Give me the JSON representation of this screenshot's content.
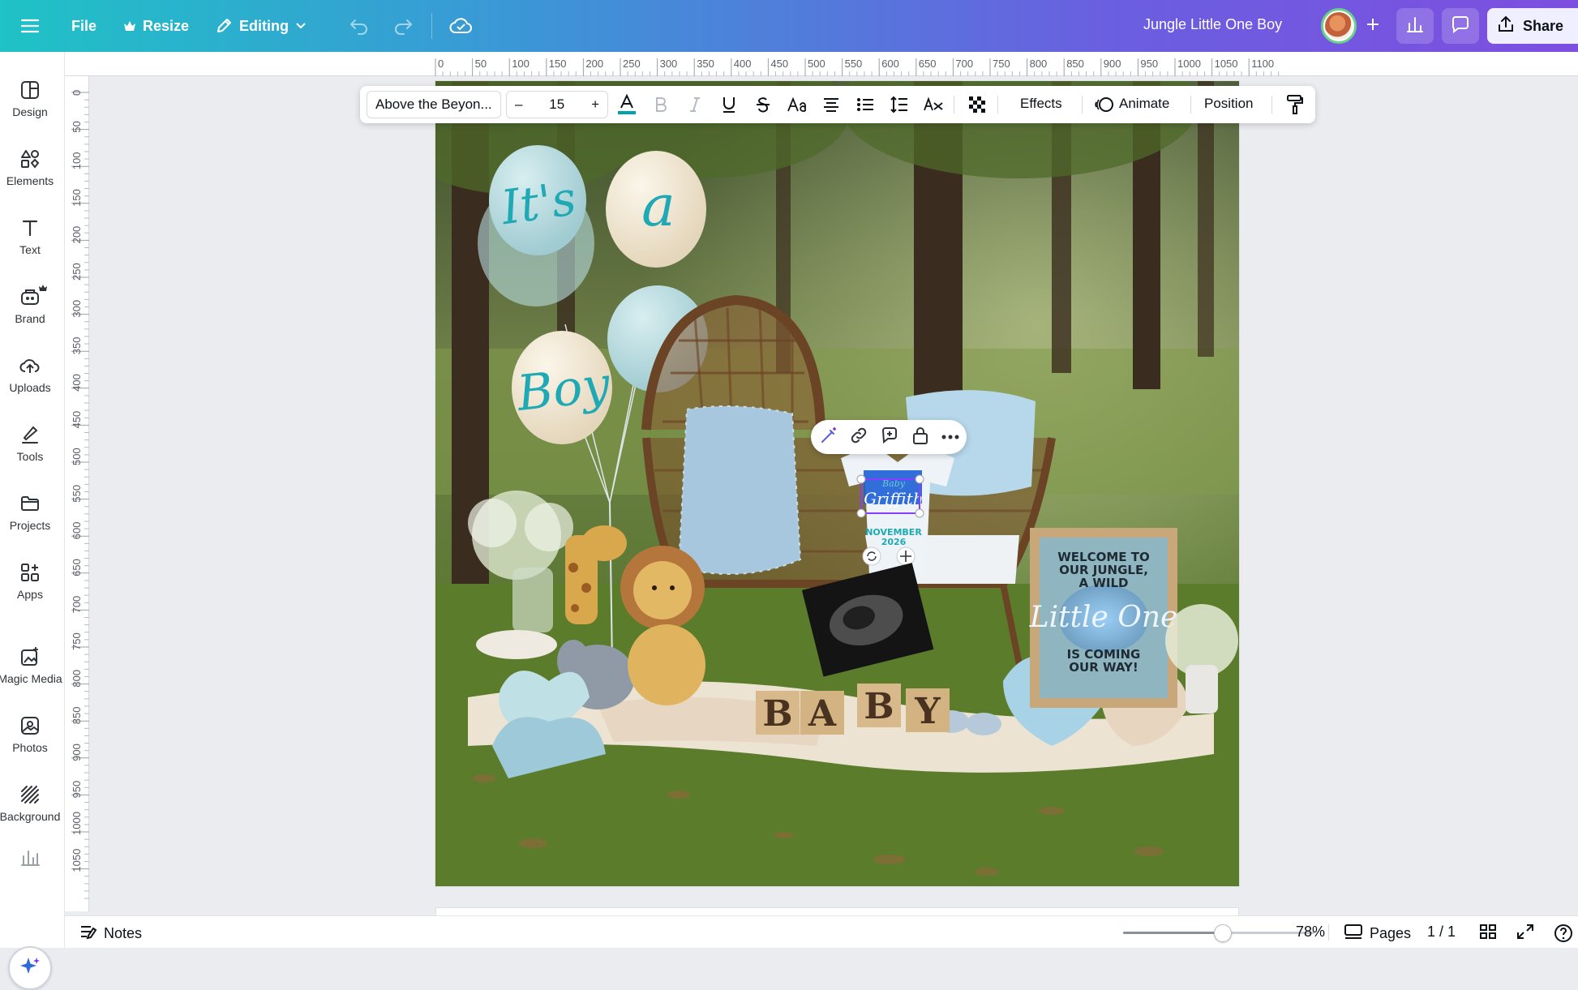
{
  "topbar": {
    "file_label": "File",
    "resize_label": "Resize",
    "mode_label": "Editing",
    "document_title": "Jungle Little One Boy",
    "share_label": "Share"
  },
  "sidebar": {
    "items": [
      {
        "label": "Design",
        "icon": "design-icon"
      },
      {
        "label": "Elements",
        "icon": "elements-icon"
      },
      {
        "label": "Text",
        "icon": "text-icon"
      },
      {
        "label": "Brand",
        "icon": "brand-icon"
      },
      {
        "label": "Uploads",
        "icon": "uploads-icon"
      },
      {
        "label": "Tools",
        "icon": "tools-icon"
      },
      {
        "label": "Projects",
        "icon": "projects-icon"
      },
      {
        "label": "Apps",
        "icon": "apps-icon"
      },
      {
        "label": "Magic Media",
        "icon": "magic-media-icon"
      },
      {
        "label": "Photos",
        "icon": "photos-icon"
      },
      {
        "label": "Background",
        "icon": "background-icon"
      }
    ]
  },
  "ruler": {
    "top_ticks": [
      "0",
      "50",
      "100",
      "150",
      "200",
      "250",
      "300",
      "350",
      "400",
      "450",
      "500",
      "550",
      "600",
      "650",
      "700",
      "750",
      "800",
      "850",
      "900",
      "950",
      "1000",
      "1050",
      "1100"
    ],
    "left_ticks": [
      "0",
      "50",
      "100",
      "150",
      "200",
      "250",
      "300",
      "350",
      "400",
      "450",
      "500",
      "550",
      "600",
      "650",
      "700",
      "750",
      "800",
      "850",
      "900",
      "950",
      "1000",
      "1050"
    ]
  },
  "text_toolbar": {
    "font_name": "Above the Beyon...",
    "font_size": "15",
    "minus": "–",
    "plus": "+",
    "effects_label": "Effects",
    "animate_label": "Animate",
    "position_label": "Position",
    "text_color": "#00a3ad"
  },
  "design": {
    "balloon_1": "It's",
    "balloon_2": "a",
    "balloon_3": "Boy",
    "onesie_small": "Baby",
    "onesie_name": "Griffith",
    "onesie_month": "NOVEMBER",
    "onesie_year": "2026",
    "blocks": [
      "B",
      "A",
      "B",
      "Y"
    ],
    "board_line_1": "WELCOME TO",
    "board_line_2": "OUR JUNGLE,",
    "board_line_3": "A WILD",
    "board_script": "Little One",
    "board_line_4": "IS COMING",
    "board_line_5": "OUR WAY!"
  },
  "bottombar": {
    "notes_label": "Notes",
    "zoom": "78%",
    "zoom_level": 0.52,
    "pages_label": "Pages",
    "page_count": "1 / 1"
  },
  "colors": {
    "accent": "#7d2ae8",
    "teal": "#00c4cc",
    "balloon_text": "#1fa9b4"
  }
}
